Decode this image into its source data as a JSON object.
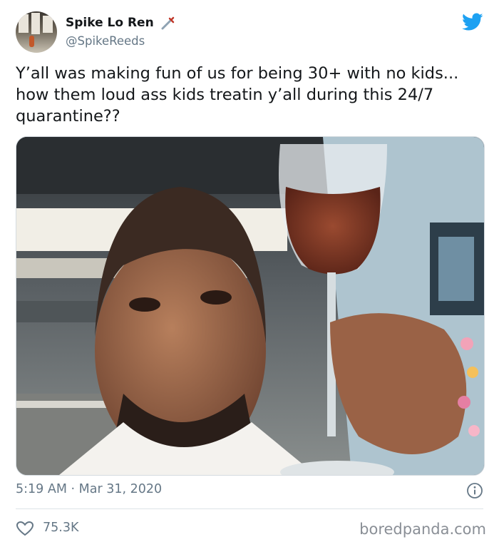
{
  "tweet": {
    "author_name": "Spike Lo Ren",
    "author_handle": "@SpikeReeds",
    "text": "Y’all was making fun of us for being 30+ with no kids... how them loud ass kids treatin y’all during this 24/7 quarantine??",
    "timestamp": "5:19 AM · Mar 31, 2020",
    "likes": "75.3K"
  },
  "icons": {
    "platform": "twitter-bird-icon",
    "name_emoji": "dagger-icon",
    "info": "info-icon",
    "like": "heart-icon"
  },
  "media": {
    "kind": "photo"
  },
  "watermark": "boredpanda.com",
  "colors": {
    "twitter_blue": "#1da1f2",
    "secondary_text": "#657786",
    "primary_text": "#14171a",
    "divider": "#dde3e7"
  }
}
